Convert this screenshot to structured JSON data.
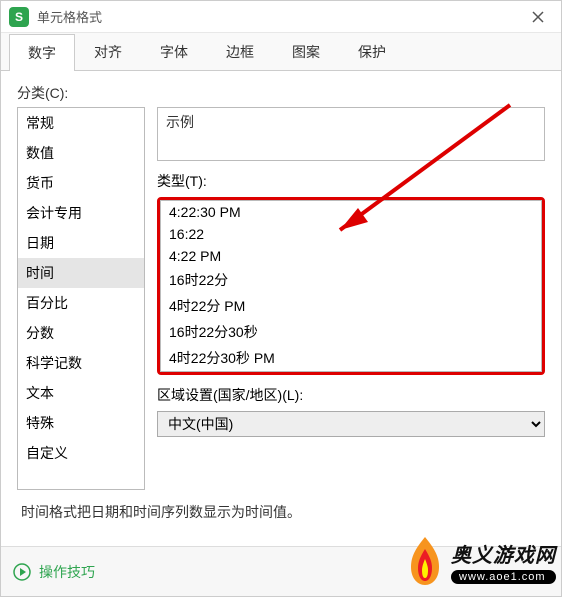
{
  "window": {
    "title": "单元格格式"
  },
  "tabs": [
    "数字",
    "对齐",
    "字体",
    "边框",
    "图案",
    "保护"
  ],
  "active_tab": 0,
  "category_label": "分类(C):",
  "categories": [
    "常规",
    "数值",
    "货币",
    "会计专用",
    "日期",
    "时间",
    "百分比",
    "分数",
    "科学记数",
    "文本",
    "特殊",
    "自定义"
  ],
  "selected_category_index": 5,
  "example_label": "示例",
  "type_label": "类型(T):",
  "types": [
    "4:22:30 PM",
    "16:22",
    "4:22 PM",
    "16时22分",
    "4时22分 PM",
    "16时22分30秒",
    "4时22分30秒 PM"
  ],
  "locale_label": "区域设置(国家/地区)(L):",
  "locale_value": "中文(中国)",
  "description": "时间格式把日期和时间序列数显示为时间值。",
  "tips_label": "操作技巧",
  "watermark": {
    "site_cn": "奥义游戏网",
    "site_url": "www.aoe1.com"
  },
  "colors": {
    "highlight_border": "#d00",
    "accent": "#2ea44f"
  }
}
